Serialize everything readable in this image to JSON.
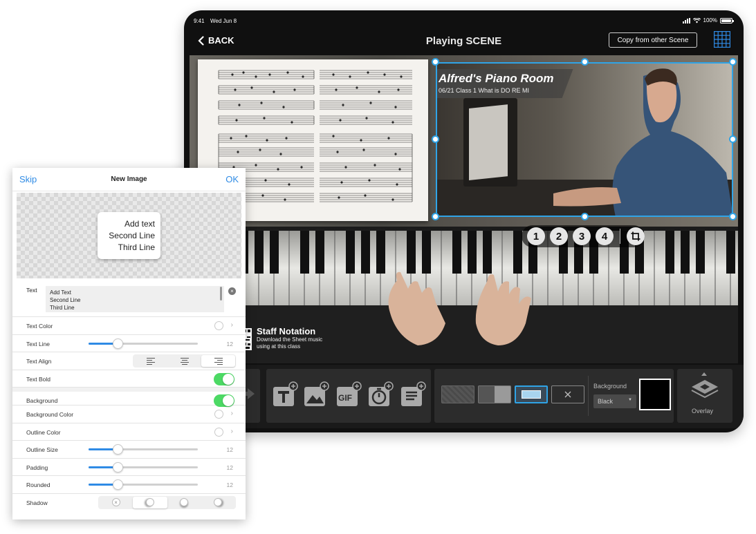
{
  "status_bar": {
    "time": "9:41",
    "date": "Wed Jun 8",
    "battery": "100%"
  },
  "navbar": {
    "back_label": "BACK",
    "title": "Playing SCENE",
    "copy_label": "Copy from other Scene"
  },
  "video": {
    "title": "Alfred's Piano Room",
    "subtitle": "06/21 Class 1  What is DO RE MI"
  },
  "scene_buttons": [
    "1",
    "2",
    "3",
    "4"
  ],
  "staff": {
    "title": "Staff Notation",
    "line1": "Download the Sheet music",
    "line2": "using at this class"
  },
  "toolbar": {
    "background_label": "Background",
    "background_select": "Black",
    "overlay_label": "Overlay",
    "gif_label": "GIF"
  },
  "dialog": {
    "skip": "Skip",
    "title": "New Image",
    "ok": "OK",
    "preview_lines": [
      "Add text",
      "Second Line",
      "Third Line"
    ],
    "text_label": "Text",
    "text_lines": [
      "Add Text",
      "Second Line",
      "Third Line"
    ],
    "text_color": "Text Color",
    "text_line": "Text Line",
    "text_line_value": "12",
    "text_align": "Text Align",
    "text_bold": "Text Bold",
    "background": "Background",
    "background_color": "Background Color",
    "outline_color": "Outline Color",
    "outline_size": "Outline Size",
    "outline_size_value": "12",
    "padding": "Padding",
    "padding_value": "12",
    "rounded": "Rounded",
    "rounded_value": "12",
    "shadow": "Shadow",
    "shadow_none": "×"
  },
  "slider_levels": {
    "text_line": 0.27,
    "outline_size": 0.27,
    "padding": 0.27,
    "rounded": 0.27
  },
  "colors": {
    "accent": "#2f8be5",
    "selection": "#2fa4e7",
    "toggle_on": "#4cd964"
  }
}
